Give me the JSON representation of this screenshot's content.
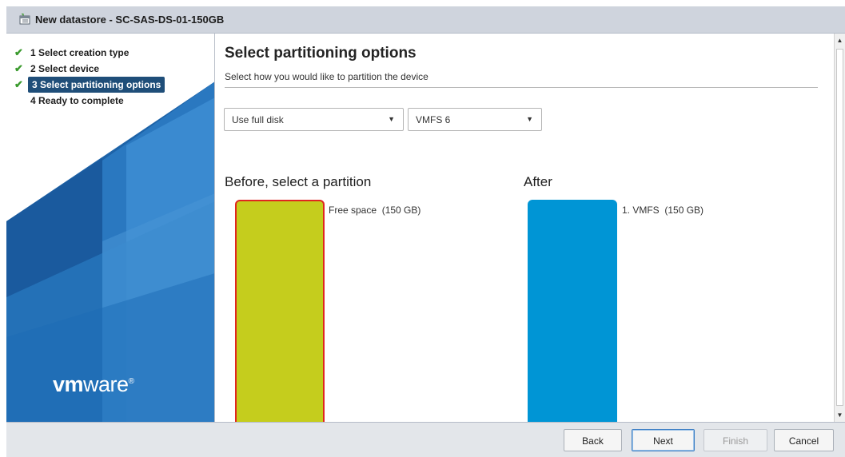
{
  "window": {
    "title": "New datastore - SC-SAS-DS-01-150GB"
  },
  "steps": [
    {
      "number_label": "1 Select creation type",
      "completed": true
    },
    {
      "number_label": "2 Select device",
      "completed": true
    },
    {
      "number_label": "3 Select partitioning options",
      "completed": true,
      "active": true
    },
    {
      "number_label": "4 Ready to complete",
      "completed": false
    }
  ],
  "brand": {
    "logo_bold": "vm",
    "logo_rest": "ware",
    "mark": "®"
  },
  "main": {
    "heading": "Select partitioning options",
    "subheading": "Select how you would like to partition the device",
    "partition_select": {
      "value": "Use full disk"
    },
    "vmfs_select": {
      "value": "VMFS 6"
    },
    "before_title": "Before, select a partition",
    "after_title": "After",
    "before_partition": {
      "label": "Free space  (150 GB)",
      "color": "#c5cd1d"
    },
    "after_partition": {
      "label": "1. VMFS  (150 GB)",
      "color": "#0095d5"
    }
  },
  "footer": {
    "back": "Back",
    "next": "Next",
    "finish": "Finish",
    "cancel": "Cancel"
  },
  "colors": {
    "accent": "#1f4e79",
    "check": "#3a9a2d",
    "selection_border": "#e0261f"
  }
}
